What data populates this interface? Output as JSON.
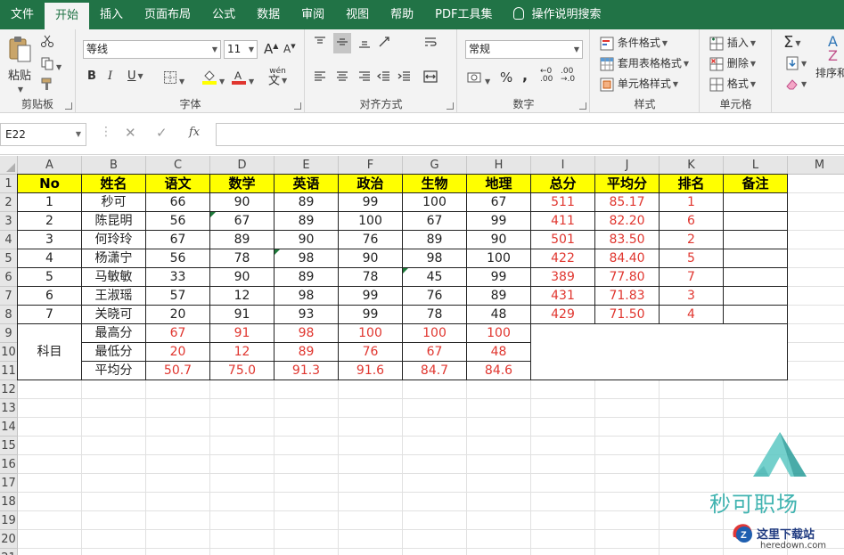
{
  "tabs": [
    {
      "label": "文件",
      "active": false
    },
    {
      "label": "开始",
      "active": true
    },
    {
      "label": "插入",
      "active": false
    },
    {
      "label": "页面布局",
      "active": false
    },
    {
      "label": "公式",
      "active": false
    },
    {
      "label": "数据",
      "active": false
    },
    {
      "label": "审阅",
      "active": false
    },
    {
      "label": "视图",
      "active": false
    },
    {
      "label": "帮助",
      "active": false
    },
    {
      "label": "PDF工具集",
      "active": false
    }
  ],
  "tell_me": "操作说明搜索",
  "ribbon": {
    "clipboard": {
      "paste": "粘贴",
      "label": "剪贴板"
    },
    "font": {
      "family": "等线",
      "size": "11",
      "label": "字体",
      "bold": "B",
      "italic": "I",
      "underline": "U",
      "grow": "A",
      "shrink": "A",
      "phonetic": "wén"
    },
    "align": {
      "label": "对齐方式"
    },
    "number": {
      "format": "常规",
      "percent": "%",
      "comma": ",",
      "label": "数字"
    },
    "styles": {
      "conditional": "条件格式",
      "table": "套用表格格式",
      "cell": "单元格样式",
      "label": "样式"
    },
    "cells": {
      "insert": "插入",
      "delete": "删除",
      "format": "格式",
      "label": "单元格"
    },
    "editing": {
      "sort": "排序和"
    }
  },
  "formula_bar": {
    "name_box": "E22",
    "fx": "fx",
    "formula": ""
  },
  "colors": {
    "accent": "#217346",
    "header_fill": "#ffff00",
    "red_text": "#e0362f"
  },
  "columns": [
    "A",
    "B",
    "C",
    "D",
    "E",
    "F",
    "G",
    "H",
    "I",
    "J",
    "K",
    "L",
    "M"
  ],
  "rows": [
    "1",
    "2",
    "3",
    "4",
    "5",
    "6",
    "7",
    "8",
    "9",
    "10",
    "11",
    "12",
    "13",
    "14",
    "15",
    "16",
    "17",
    "18",
    "19",
    "20",
    "21"
  ],
  "table": {
    "headers": [
      "No",
      "姓名",
      "语文",
      "数学",
      "英语",
      "政治",
      "生物",
      "地理",
      "总分",
      "平均分",
      "排名",
      "备注"
    ],
    "rows": [
      [
        "1",
        "秒可",
        "66",
        "90",
        "89",
        "99",
        "100",
        "67",
        "511",
        "85.17",
        "1",
        ""
      ],
      [
        "2",
        "陈昆明",
        "56",
        "67",
        "89",
        "100",
        "67",
        "99",
        "411",
        "82.20",
        "6",
        ""
      ],
      [
        "3",
        "何玲玲",
        "67",
        "89",
        "90",
        "76",
        "89",
        "90",
        "501",
        "83.50",
        "2",
        ""
      ],
      [
        "4",
        "杨潇宁",
        "56",
        "78",
        "98",
        "90",
        "98",
        "100",
        "422",
        "84.40",
        "5",
        ""
      ],
      [
        "5",
        "马敏敏",
        "33",
        "90",
        "89",
        "78",
        "45",
        "99",
        "389",
        "77.80",
        "7",
        ""
      ],
      [
        "6",
        "王淑瑶",
        "57",
        "12",
        "98",
        "99",
        "76",
        "89",
        "431",
        "71.83",
        "3",
        ""
      ],
      [
        "7",
        "关晓可",
        "20",
        "91",
        "93",
        "99",
        "78",
        "48",
        "429",
        "71.50",
        "4",
        ""
      ]
    ],
    "subject_label": "科目",
    "stats": [
      {
        "label": "最高分",
        "values": [
          "67",
          "91",
          "98",
          "100",
          "100",
          "100"
        ]
      },
      {
        "label": "最低分",
        "values": [
          "20",
          "12",
          "89",
          "76",
          "67",
          "48"
        ]
      },
      {
        "label": "平均分",
        "values": [
          "50.7",
          "75.0",
          "91.3",
          "91.6",
          "84.7",
          "84.6"
        ]
      }
    ]
  },
  "watermark": {
    "brand": "秒可职场",
    "site_name": "这里下载站",
    "site_domain": "heredown.com"
  }
}
